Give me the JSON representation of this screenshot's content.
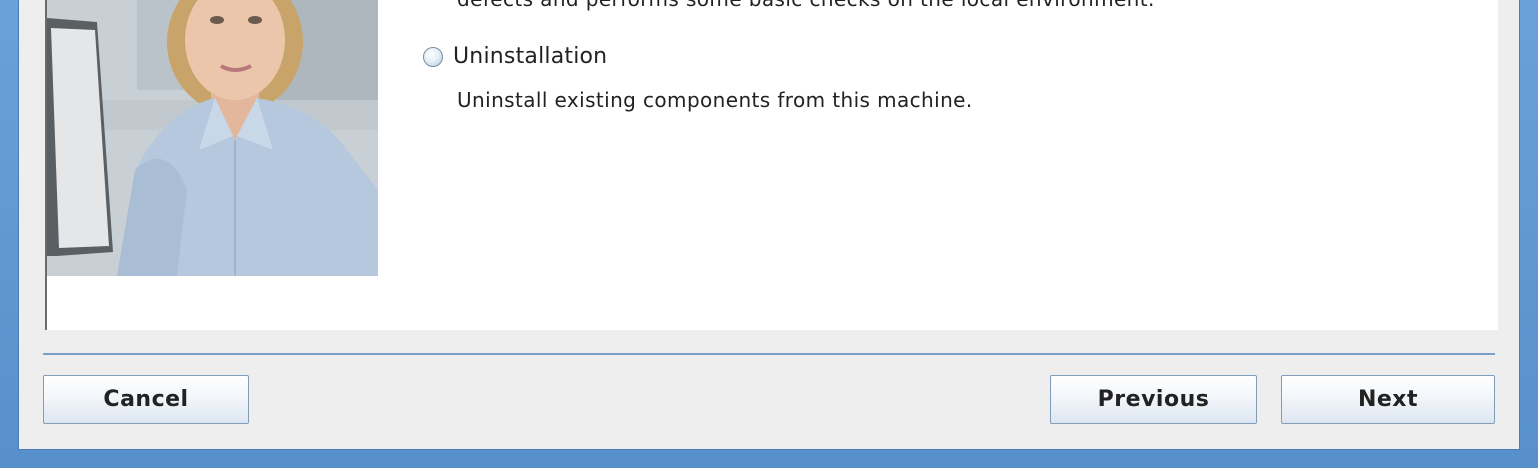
{
  "content": {
    "cut_off_text": "defects and performs some basic checks on the local environment.",
    "options": [
      {
        "label": "Uninstallation",
        "description": "Uninstall existing components from this machine.",
        "selected": false
      }
    ]
  },
  "footer": {
    "cancel_label": "Cancel",
    "previous_label": "Previous",
    "next_label": "Next"
  },
  "colors": {
    "frame": "#5f97cf",
    "dialog_bg": "#eeeeee",
    "content_bg": "#ffffff",
    "separator": "#7b9fcb"
  }
}
